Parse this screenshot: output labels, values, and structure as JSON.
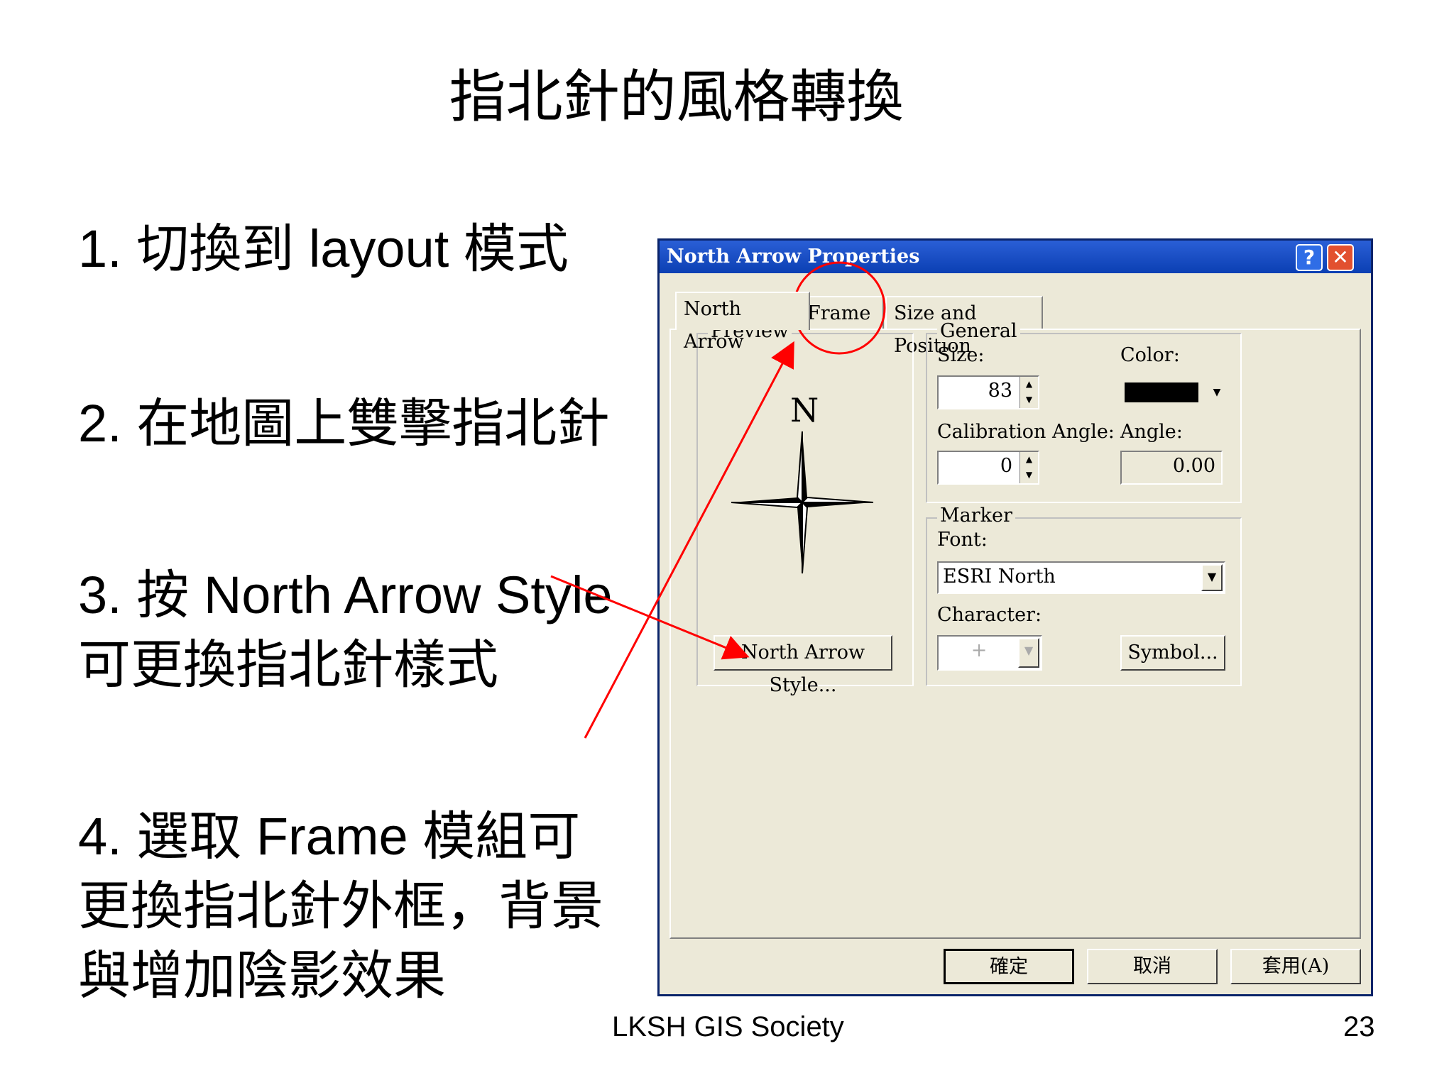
{
  "slide": {
    "title": "指北針的風格轉換",
    "steps": [
      "1. 切換到 layout 模式",
      "2. 在地圖上雙擊指北針",
      "3. 按 North Arrow Style  可更換指北針樣式",
      "4. 選取 Frame  模組可更換指北針外框，背景與增加陰影效果"
    ],
    "footer": "LKSH  GIS Society",
    "page_number": "23",
    "annotation_color": "#ff0000"
  },
  "dialog": {
    "title": "North Arrow Properties",
    "help_label": "?",
    "close_label": "✕",
    "tabs": [
      "North Arrow",
      "Frame",
      "Size and Position"
    ],
    "preview": {
      "legend": "Preview",
      "arrow_letter": "N",
      "style_button": "North Arrow Style..."
    },
    "general": {
      "legend": "General",
      "size_label": "Size:",
      "size_value": "83",
      "color_label": "Color:",
      "color_value": "#000000",
      "calibration_label": "Calibration Angle:",
      "calibration_value": "0",
      "angle_label": "Angle:",
      "angle_value": "0.00"
    },
    "marker": {
      "legend": "Marker",
      "font_label": "Font:",
      "font_value": "ESRI North",
      "character_label": "Character:",
      "character_value": "+",
      "symbol_button": "Symbol..."
    },
    "buttons": {
      "ok": "確定",
      "cancel": "取消",
      "apply": "套用(A)"
    }
  }
}
